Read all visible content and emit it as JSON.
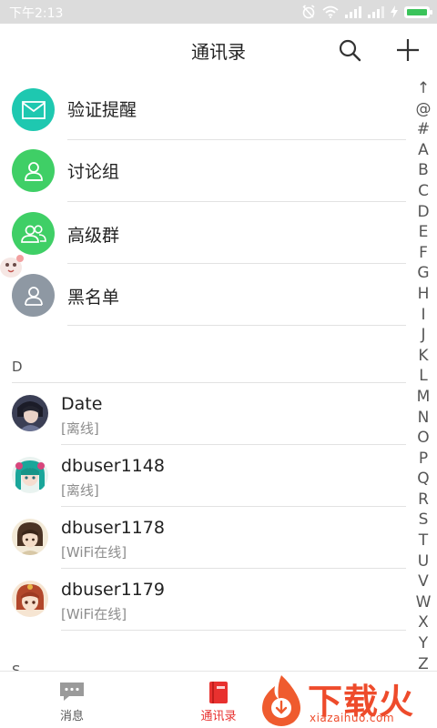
{
  "status_bar": {
    "time": "下午2:13",
    "icons": [
      "alarm-icon",
      "wifi-icon",
      "signal-icon",
      "4g-signal-icon",
      "charging-icon",
      "battery-icon"
    ],
    "battery_level": 1.0,
    "battery_color": "#3ac35a"
  },
  "header": {
    "title": "通讯录",
    "search_icon": "search-icon",
    "add_icon": "plus-icon"
  },
  "features": [
    {
      "label": "验证提醒",
      "icon": "mail-icon",
      "color": "#1ec8b0"
    },
    {
      "label": "讨论组",
      "icon": "person-icon",
      "color": "#3fcf66"
    },
    {
      "label": "高级群",
      "icon": "group-icon",
      "color": "#3fcf66"
    },
    {
      "label": "黑名单",
      "icon": "person-icon",
      "color": "#8e98a3"
    }
  ],
  "sections": [
    {
      "letter": "D",
      "contacts": [
        {
          "name": "Date",
          "status": "[离线]"
        },
        {
          "name": "dbuser1148",
          "status": "[离线]"
        },
        {
          "name": "dbuser1178",
          "status": "[WiFi在线]"
        },
        {
          "name": "dbuser1179",
          "status": "[WiFi在线]"
        }
      ]
    },
    {
      "letter": "S"
    }
  ],
  "index_bar": [
    "↑",
    "@",
    "#",
    "A",
    "B",
    "C",
    "D",
    "E",
    "F",
    "G",
    "H",
    "I",
    "J",
    "K",
    "L",
    "M",
    "N",
    "O",
    "P",
    "Q",
    "R",
    "S",
    "T",
    "U",
    "V",
    "W",
    "X",
    "Y",
    "Z"
  ],
  "bottom_nav": [
    {
      "label": "消息",
      "icon": "message-icon",
      "active": false
    },
    {
      "label": "通讯录",
      "icon": "contacts-book-icon",
      "active": true
    }
  ],
  "colors": {
    "accent": "#e8312f",
    "inactive": "#555555"
  },
  "watermark": {
    "brand": "下载火",
    "url": "xiazaihuo.com"
  }
}
